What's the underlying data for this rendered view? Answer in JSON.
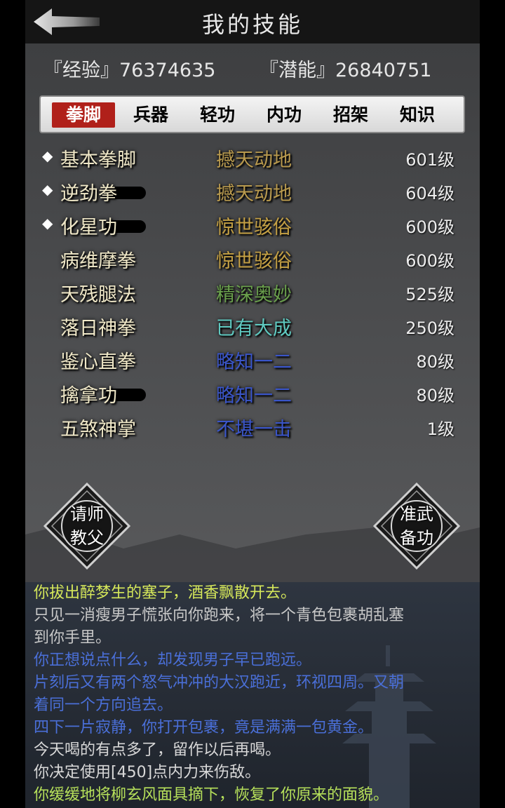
{
  "header": {
    "title": "我的技能"
  },
  "stats": {
    "exp": "『经验』76374635",
    "potential": "『潜能』26840751"
  },
  "tabs": [
    {
      "label": "拳脚",
      "active": true
    },
    {
      "label": "兵器",
      "active": false
    },
    {
      "label": "轻功",
      "active": false
    },
    {
      "label": "内功",
      "active": false
    },
    {
      "label": "招架",
      "active": false
    },
    {
      "label": "知识",
      "active": false
    }
  ],
  "skills": [
    {
      "name": "基本拳脚",
      "level": "撼天动地",
      "num": "601级",
      "diamond": true,
      "level_color": "#b99a4e"
    },
    {
      "name": "逆劲拳",
      "level": "撼天动地",
      "num": "604级",
      "diamond": true,
      "level_color": "#b99a4e"
    },
    {
      "name": "化星功",
      "level": "惊世骇俗",
      "num": "600级",
      "diamond": true,
      "level_color": "#c4a044"
    },
    {
      "name": "病维摩拳",
      "level": "惊世骇俗",
      "num": "600级",
      "diamond": false,
      "level_color": "#c4a044"
    },
    {
      "name": "天残腿法",
      "level": "精深奥妙",
      "num": "525级",
      "diamond": false,
      "level_color": "#6aa04c"
    },
    {
      "name": "落日神拳",
      "level": "已有大成",
      "num": "250级",
      "diamond": false,
      "level_color": "#5fc9c0"
    },
    {
      "name": "鉴心直拳",
      "level": "略知一二",
      "num": "80级",
      "diamond": false,
      "level_color": "#3a55c8"
    },
    {
      "name": "擒拿功",
      "level": "略知一二",
      "num": "80级",
      "diamond": false,
      "level_color": "#3a55c8"
    },
    {
      "name": "五煞神掌",
      "level": "不堪一击",
      "num": "1级",
      "diamond": false,
      "level_color": "#3a55c8"
    }
  ],
  "buttons": {
    "teacher": "请师\n教父",
    "prepare": "准武\n备功"
  },
  "log": [
    {
      "text": "你拔出醉梦生的塞子，酒香飘散开去。",
      "color": "#d6e85a"
    },
    {
      "text": "只见一消瘦男子慌张向你跑来，将一个青色包裹胡乱塞",
      "color": "#c8c8c8"
    },
    {
      "text": "到你手里。",
      "color": "#c8c8c8"
    },
    {
      "text": "你正想说点什么，却发现男子早已跑远。",
      "color": "#4a6fd8"
    },
    {
      "text": "片刻后又有两个怒气冲冲的大汉跑近，环视四周。又朝",
      "color": "#4a6fd8"
    },
    {
      "text": "着同一个方向追去。",
      "color": "#4a6fd8"
    },
    {
      "text": "四下一片寂静，你打开包裹，竟是满满一包黄金。",
      "color": "#4a6fd8"
    },
    {
      "text": "今天喝的有点多了，留作以后再喝。",
      "color": "#d8d8d8"
    },
    {
      "text": "你决定使用[450]点内力来伤敌。",
      "color": "#d8d8d8"
    },
    {
      "text": "你缓缓地将柳玄风面具摘下，恢复了你原来的面貌。",
      "color": "#b6e05a"
    }
  ]
}
